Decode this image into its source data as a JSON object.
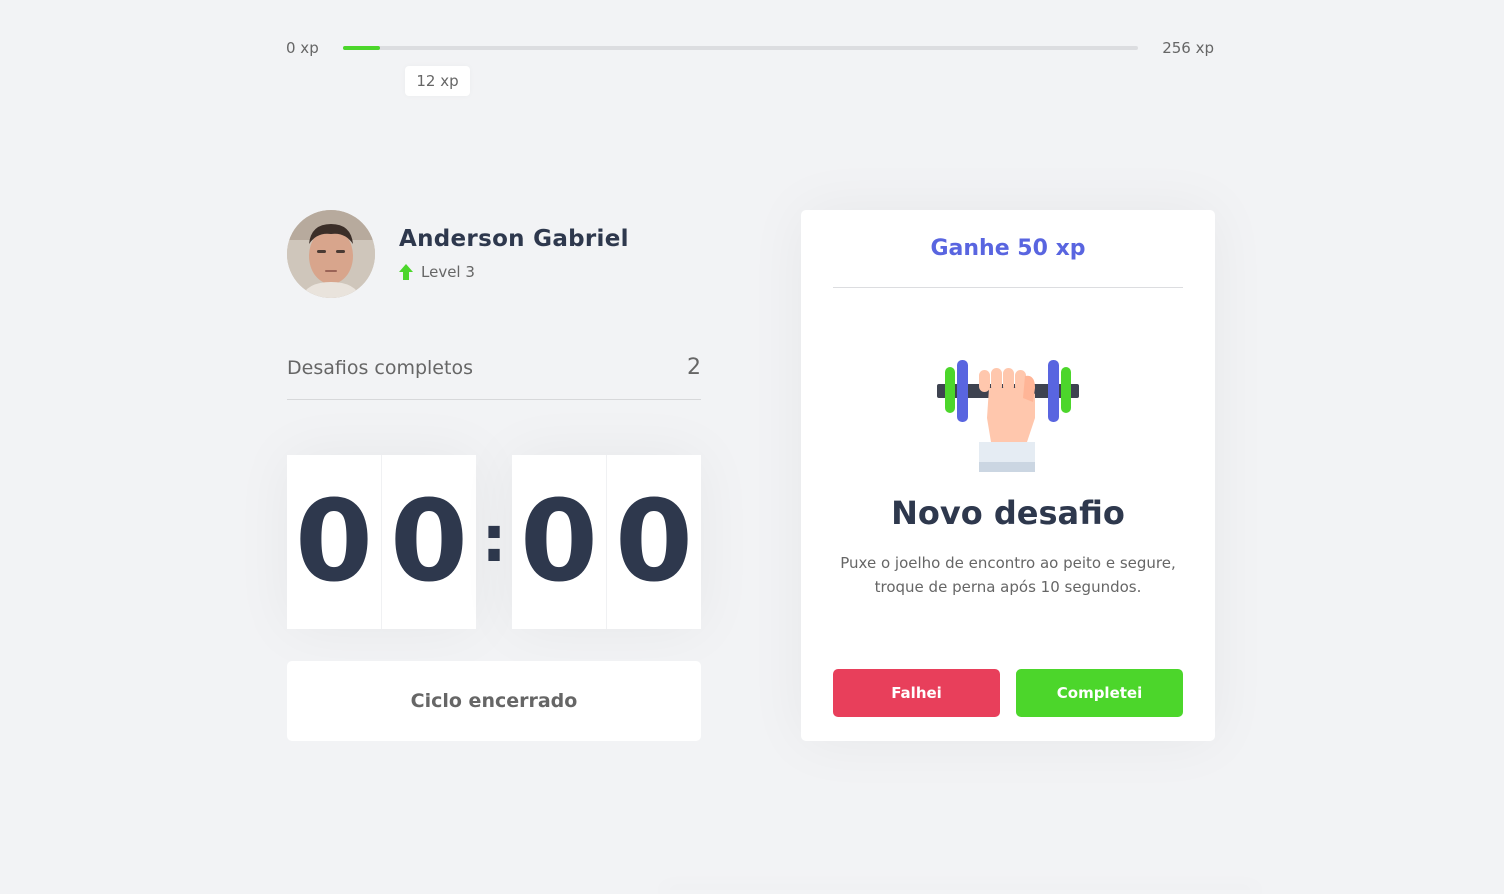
{
  "experience": {
    "min_label": "0 xp",
    "max_label": "256 xp",
    "current_label": "12 xp",
    "current": 12,
    "max": 256,
    "progress_fraction": 0.047,
    "bar_color": "#4cd62b"
  },
  "profile": {
    "name": "Anderson Gabriel",
    "level_label": "Level 3",
    "level_icon": "level-up-arrow-icon"
  },
  "completed_challenges": {
    "label": "Desafios completos",
    "value": "2"
  },
  "countdown": {
    "minute_left": "0",
    "minute_right": "0",
    "separator": ":",
    "second_left": "0",
    "second_right": "0"
  },
  "cycle_button": {
    "label": "Ciclo encerrado"
  },
  "challenge": {
    "header": "Ganhe 50 xp",
    "icon": "dumbbell-icon",
    "title": "Novo desafio",
    "description": "Puxe o joelho de encontro ao peito e segure, troque de perna após 10 segundos.",
    "fail_label": "Falhei",
    "success_label": "Completei"
  },
  "colors": {
    "background": "#f2f3f5",
    "accent": "#5965e0",
    "red": "#e83f5b",
    "green": "#4cd62b",
    "title": "#2e384d",
    "text": "#666666"
  }
}
